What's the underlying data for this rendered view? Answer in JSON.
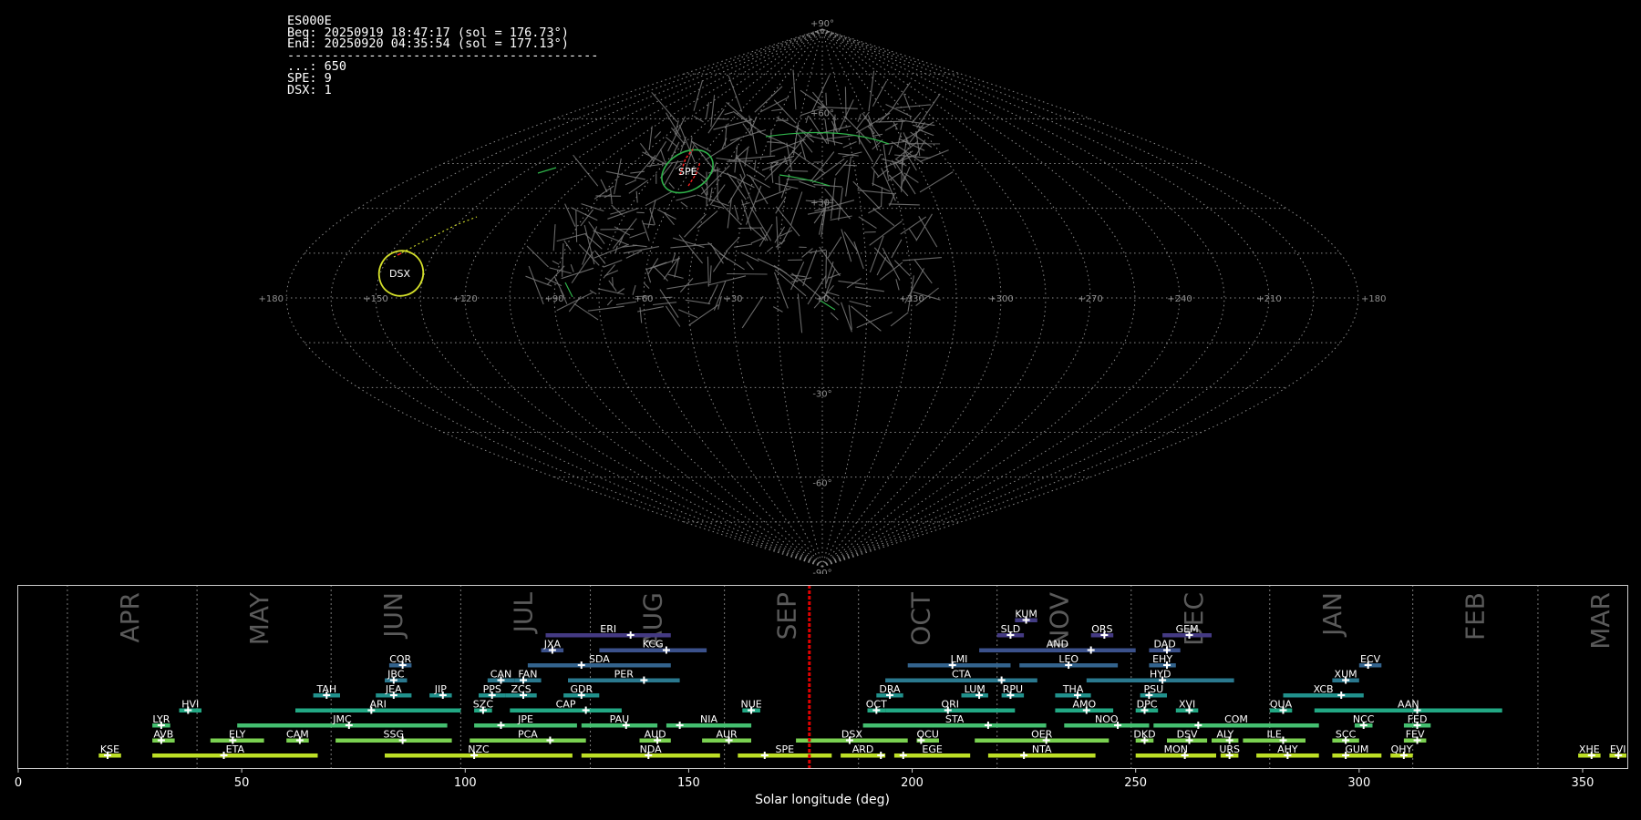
{
  "info": {
    "station": "ES000E",
    "beg": "Beg: 20250919 18:47:17 (sol = 176.73°)",
    "end": "End: 20250920 04:35:54 (sol = 177.13°)",
    "separator": "------------------------------------------",
    "sporadic": "...: 650",
    "spe": "SPE: 9",
    "dsx": "DSX: 1"
  },
  "sky": {
    "ra_labels": [
      "+180",
      "+150",
      "+120",
      "+90",
      "+60",
      "+30",
      "+0",
      "+330",
      "+300",
      "+270",
      "+240",
      "+210",
      "+180"
    ],
    "dec_labels": [
      "+90°",
      "+60°",
      "+30°",
      "-30°",
      "-60°",
      "-90°"
    ],
    "showers": [
      {
        "code": "SPE",
        "color": "#2fb34a",
        "meteor_color": "#ff2020"
      },
      {
        "code": "DSX",
        "color": "#d4e02a",
        "meteor_color": "#ff2020"
      }
    ]
  },
  "timeline": {
    "xlabel": "Solar longitude (deg)",
    "xlim": [
      0,
      360
    ],
    "xticks": [
      0,
      50,
      100,
      150,
      200,
      250,
      300,
      350
    ],
    "current_sol": 177.0,
    "months": [
      {
        "label": "APR",
        "start": 11
      },
      {
        "label": "MAY",
        "start": 40
      },
      {
        "label": "JUN",
        "start": 70
      },
      {
        "label": "JUL",
        "start": 99
      },
      {
        "label": "AUG",
        "start": 128
      },
      {
        "label": "SEP",
        "start": 158
      },
      {
        "label": "OCT",
        "start": 188
      },
      {
        "label": "NOV",
        "start": 219
      },
      {
        "label": "DEC",
        "start": 249
      },
      {
        "label": "JAN",
        "start": 280
      },
      {
        "label": "FEB",
        "start": 312
      },
      {
        "label": "MAR",
        "start": 340
      }
    ],
    "showers": [
      {
        "code": "KUM",
        "start": 223,
        "end": 228,
        "peak": 225.5,
        "row": 10,
        "color": "#433d84"
      },
      {
        "code": "ERI",
        "start": 118,
        "end": 146,
        "peak": 137,
        "row": 9,
        "color": "#443a83"
      },
      {
        "code": "SLD",
        "start": 219,
        "end": 225,
        "peak": 222,
        "row": 9,
        "color": "#443a83"
      },
      {
        "code": "ORS",
        "start": 240,
        "end": 245,
        "peak": 243,
        "row": 9,
        "color": "#443a83"
      },
      {
        "code": "GEM",
        "start": 256,
        "end": 267,
        "peak": 262,
        "row": 9,
        "color": "#443a83"
      },
      {
        "code": "JXA",
        "start": 117,
        "end": 122,
        "peak": 119.5,
        "row": 8,
        "color": "#3b518b"
      },
      {
        "code": "KCG",
        "start": 130,
        "end": 154,
        "peak": 145,
        "row": 8,
        "color": "#3b518b"
      },
      {
        "code": "AND",
        "start": 215,
        "end": 250,
        "peak": 240,
        "row": 8,
        "color": "#3b518b"
      },
      {
        "code": "DAD",
        "start": 253,
        "end": 260,
        "peak": 257,
        "row": 8,
        "color": "#3b518b"
      },
      {
        "code": "COR",
        "start": 83,
        "end": 88,
        "peak": 86,
        "row": 7,
        "color": "#33638d"
      },
      {
        "code": "SDA",
        "start": 114,
        "end": 146,
        "peak": 126,
        "row": 7,
        "color": "#33638d"
      },
      {
        "code": "LMI",
        "start": 199,
        "end": 222,
        "peak": 209,
        "row": 7,
        "color": "#33638d"
      },
      {
        "code": "LEO",
        "start": 224,
        "end": 246,
        "peak": 235,
        "row": 7,
        "color": "#33638d"
      },
      {
        "code": "EHY",
        "start": 253,
        "end": 259,
        "peak": 257,
        "row": 7,
        "color": "#33638d"
      },
      {
        "code": "ECV",
        "start": 300,
        "end": 305,
        "peak": 302,
        "row": 7,
        "color": "#33638d"
      },
      {
        "code": "JBC",
        "start": 82,
        "end": 87,
        "peak": 84,
        "row": 6,
        "color": "#2a788e"
      },
      {
        "code": "CAN",
        "start": 105,
        "end": 111,
        "peak": 108,
        "row": 6,
        "color": "#2a788e"
      },
      {
        "code": "FAN",
        "start": 111,
        "end": 117,
        "peak": 113,
        "row": 6,
        "color": "#2a788e"
      },
      {
        "code": "PER",
        "start": 123,
        "end": 148,
        "peak": 140,
        "row": 6,
        "color": "#2a788e"
      },
      {
        "code": "CTA",
        "start": 194,
        "end": 228,
        "peak": 220,
        "row": 6,
        "color": "#2a788e"
      },
      {
        "code": "HYD",
        "start": 239,
        "end": 272,
        "peak": 256,
        "row": 6,
        "color": "#2a788e"
      },
      {
        "code": "XUM",
        "start": 294,
        "end": 300,
        "peak": 297,
        "row": 6,
        "color": "#2a788e"
      },
      {
        "code": "TAH",
        "start": 66,
        "end": 72,
        "peak": 69,
        "row": 5,
        "color": "#21918c"
      },
      {
        "code": "JEA",
        "start": 80,
        "end": 88,
        "peak": 84,
        "row": 5,
        "color": "#21918c"
      },
      {
        "code": "JIP",
        "start": 92,
        "end": 97,
        "peak": 95,
        "row": 5,
        "color": "#21918c"
      },
      {
        "code": "PPS",
        "start": 103,
        "end": 109,
        "peak": 106,
        "row": 5,
        "color": "#21918c"
      },
      {
        "code": "ZCS",
        "start": 109,
        "end": 116,
        "peak": 113,
        "row": 5,
        "color": "#21918c"
      },
      {
        "code": "GDR",
        "start": 122,
        "end": 130,
        "peak": 126,
        "row": 5,
        "color": "#21918c"
      },
      {
        "code": "DRA",
        "start": 192,
        "end": 198,
        "peak": 195,
        "row": 5,
        "color": "#21918c"
      },
      {
        "code": "LUM",
        "start": 211,
        "end": 217,
        "peak": 215,
        "row": 5,
        "color": "#21918c"
      },
      {
        "code": "RPU",
        "start": 220,
        "end": 225,
        "peak": 222,
        "row": 5,
        "color": "#21918c"
      },
      {
        "code": "THA",
        "start": 232,
        "end": 240,
        "peak": 237,
        "row": 5,
        "color": "#21918c"
      },
      {
        "code": "PSU",
        "start": 251,
        "end": 257,
        "peak": 253,
        "row": 5,
        "color": "#21918c"
      },
      {
        "code": "XCB",
        "start": 283,
        "end": 301,
        "peak": 296,
        "row": 5,
        "color": "#21918c"
      },
      {
        "code": "HVI",
        "start": 36,
        "end": 41,
        "peak": 38,
        "row": 4,
        "color": "#22a884"
      },
      {
        "code": "ARI",
        "start": 62,
        "end": 99,
        "peak": 79,
        "row": 4,
        "color": "#22a884"
      },
      {
        "code": "SZC",
        "start": 102,
        "end": 106,
        "peak": 104,
        "row": 4,
        "color": "#22a884"
      },
      {
        "code": "CAP",
        "start": 110,
        "end": 135,
        "peak": 127,
        "row": 4,
        "color": "#22a884"
      },
      {
        "code": "NUE",
        "start": 162,
        "end": 166,
        "peak": 164,
        "row": 4,
        "color": "#22a884"
      },
      {
        "code": "OCT",
        "start": 190,
        "end": 194,
        "peak": 192,
        "row": 4,
        "color": "#22a884"
      },
      {
        "code": "ORI",
        "start": 194,
        "end": 223,
        "peak": 208,
        "row": 4,
        "color": "#22a884"
      },
      {
        "code": "AMO",
        "start": 232,
        "end": 245,
        "peak": 239,
        "row": 4,
        "color": "#22a884"
      },
      {
        "code": "DPC",
        "start": 250,
        "end": 255,
        "peak": 252,
        "row": 4,
        "color": "#22a884"
      },
      {
        "code": "XVI",
        "start": 259,
        "end": 264,
        "peak": 262,
        "row": 4,
        "color": "#22a884"
      },
      {
        "code": "QUA",
        "start": 280,
        "end": 285,
        "peak": 283,
        "row": 4,
        "color": "#22a884"
      },
      {
        "code": "AAN",
        "start": 290,
        "end": 332,
        "peak": 313,
        "row": 4,
        "color": "#22a884"
      },
      {
        "code": "LYR",
        "start": 30,
        "end": 34,
        "peak": 32,
        "row": 3,
        "color": "#44bf70"
      },
      {
        "code": "JMC",
        "start": 49,
        "end": 96,
        "peak": 74,
        "row": 3,
        "color": "#44bf70"
      },
      {
        "code": "JPE",
        "start": 102,
        "end": 125,
        "peak": 108,
        "row": 3,
        "color": "#44bf70"
      },
      {
        "code": "PAU",
        "start": 126,
        "end": 143,
        "peak": 136,
        "row": 3,
        "color": "#44bf70"
      },
      {
        "code": "NIA",
        "start": 145,
        "end": 164,
        "peak": 148,
        "row": 3,
        "color": "#44bf70"
      },
      {
        "code": "STA",
        "start": 189,
        "end": 230,
        "peak": 217,
        "row": 3,
        "color": "#44bf70"
      },
      {
        "code": "NOO",
        "start": 234,
        "end": 253,
        "peak": 246,
        "row": 3,
        "color": "#44bf70"
      },
      {
        "code": "COM",
        "start": 254,
        "end": 291,
        "peak": 264,
        "row": 3,
        "color": "#44bf70"
      },
      {
        "code": "NCC",
        "start": 299,
        "end": 303,
        "peak": 301,
        "row": 3,
        "color": "#44bf70"
      },
      {
        "code": "FED",
        "start": 310,
        "end": 316,
        "peak": 313,
        "row": 3,
        "color": "#44bf70"
      },
      {
        "code": "AVB",
        "start": 30,
        "end": 35,
        "peak": 32,
        "row": 2,
        "color": "#7ad151"
      },
      {
        "code": "ELY",
        "start": 43,
        "end": 55,
        "peak": 48,
        "row": 2,
        "color": "#7ad151"
      },
      {
        "code": "CAM",
        "start": 60,
        "end": 65,
        "peak": 63,
        "row": 2,
        "color": "#7ad151"
      },
      {
        "code": "SSG",
        "start": 71,
        "end": 97,
        "peak": 86,
        "row": 2,
        "color": "#7ad151"
      },
      {
        "code": "PCA",
        "start": 101,
        "end": 127,
        "peak": 119,
        "row": 2,
        "color": "#7ad151"
      },
      {
        "code": "AUD",
        "start": 139,
        "end": 146,
        "peak": 143,
        "row": 2,
        "color": "#7ad151"
      },
      {
        "code": "AUR",
        "start": 153,
        "end": 164,
        "peak": 159,
        "row": 2,
        "color": "#7ad151"
      },
      {
        "code": "DSX",
        "start": 174,
        "end": 199,
        "peak": 186,
        "row": 2,
        "color": "#7ad151"
      },
      {
        "code": "OCU",
        "start": 201,
        "end": 206,
        "peak": 202,
        "row": 2,
        "color": "#7ad151"
      },
      {
        "code": "OER",
        "start": 214,
        "end": 244,
        "peak": 230,
        "row": 2,
        "color": "#7ad151"
      },
      {
        "code": "DKD",
        "start": 250,
        "end": 254,
        "peak": 252,
        "row": 2,
        "color": "#7ad151"
      },
      {
        "code": "DSV",
        "start": 257,
        "end": 266,
        "peak": 262,
        "row": 2,
        "color": "#7ad151"
      },
      {
        "code": "ALY",
        "start": 267,
        "end": 273,
        "peak": 271,
        "row": 2,
        "color": "#7ad151"
      },
      {
        "code": "ILE",
        "start": 274,
        "end": 288,
        "peak": 283,
        "row": 2,
        "color": "#7ad151"
      },
      {
        "code": "SCC",
        "start": 294,
        "end": 300,
        "peak": 297,
        "row": 2,
        "color": "#7ad151"
      },
      {
        "code": "FEV",
        "start": 310,
        "end": 315,
        "peak": 313,
        "row": 2,
        "color": "#7ad151"
      },
      {
        "code": "KSE",
        "start": 18,
        "end": 23,
        "peak": 20,
        "row": 1,
        "color": "#bddf26"
      },
      {
        "code": "ETA",
        "start": 30,
        "end": 67,
        "peak": 46,
        "row": 1,
        "color": "#bddf26"
      },
      {
        "code": "NZC",
        "start": 82,
        "end": 124,
        "peak": 102,
        "row": 1,
        "color": "#bddf26"
      },
      {
        "code": "NDA",
        "start": 126,
        "end": 157,
        "peak": 141,
        "row": 1,
        "color": "#bddf26"
      },
      {
        "code": "SPE",
        "start": 161,
        "end": 182,
        "peak": 167,
        "row": 1,
        "color": "#bddf26"
      },
      {
        "code": "ARD",
        "start": 184,
        "end": 194,
        "peak": 193,
        "row": 1,
        "color": "#bddf26"
      },
      {
        "code": "EGE",
        "start": 196,
        "end": 213,
        "peak": 198,
        "row": 1,
        "color": "#bddf26"
      },
      {
        "code": "NTA",
        "start": 217,
        "end": 241,
        "peak": 225,
        "row": 1,
        "color": "#bddf26"
      },
      {
        "code": "MON",
        "start": 250,
        "end": 268,
        "peak": 261,
        "row": 1,
        "color": "#bddf26"
      },
      {
        "code": "URS",
        "start": 269,
        "end": 273,
        "peak": 271,
        "row": 1,
        "color": "#bddf26"
      },
      {
        "code": "AHY",
        "start": 277,
        "end": 291,
        "peak": 284,
        "row": 1,
        "color": "#bddf26"
      },
      {
        "code": "GUM",
        "start": 294,
        "end": 305,
        "peak": 297,
        "row": 1,
        "color": "#bddf26"
      },
      {
        "code": "QHY",
        "start": 307,
        "end": 312,
        "peak": 310,
        "row": 1,
        "color": "#bddf26"
      },
      {
        "code": "XHE",
        "start": 349,
        "end": 354,
        "peak": 352,
        "row": 1,
        "color": "#bddf26"
      },
      {
        "code": "EVI",
        "start": 356,
        "end": 361,
        "peak": 358,
        "row": 1,
        "color": "#bddf26"
      }
    ]
  }
}
